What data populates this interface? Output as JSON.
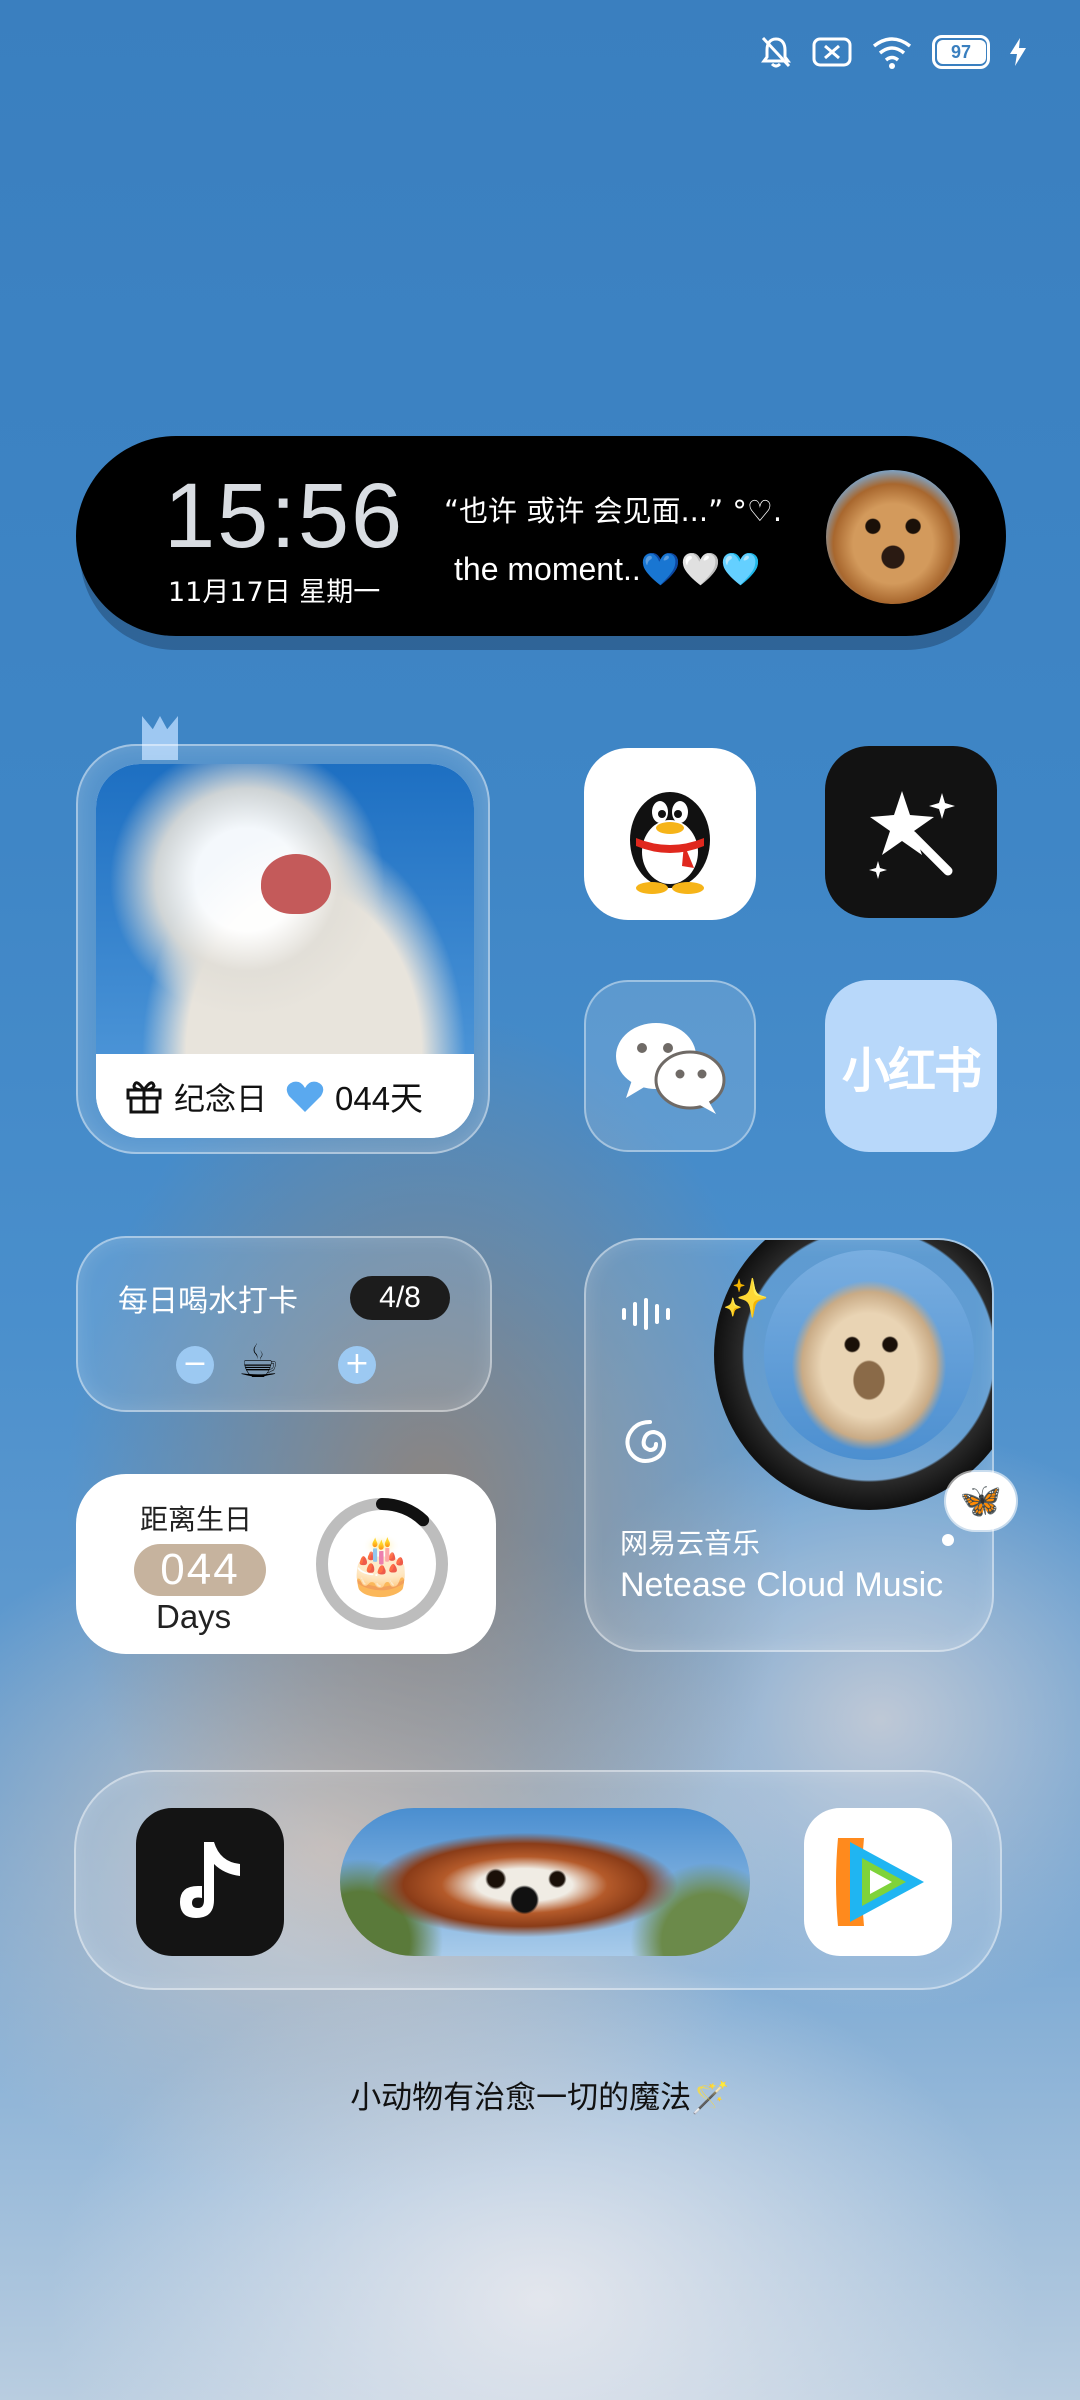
{
  "status_bar": {
    "battery_level": "97",
    "battery_fraction": 0.97
  },
  "time_widget": {
    "time": "15:56",
    "date": "11月17日  星期一",
    "quote_line1": "“也许 或许 会见面...” °♡.",
    "quote_line2": "the moment..💙🤍🩵"
  },
  "photo_widget": {
    "label": "纪念日",
    "count": "044天"
  },
  "apps": {
    "qq": "QQ",
    "magic": "Magic",
    "wechat": "WeChat",
    "xiaohongshu": "小红书",
    "tiktok": "TikTok",
    "tencent_video": "Tencent Video"
  },
  "water_widget": {
    "title": "每日喝水打卡",
    "count": "4/8",
    "minus": "−",
    "plus": "+",
    "cup": "☕"
  },
  "birthday_widget": {
    "title": "距离生日",
    "number": "044",
    "unit": "Days",
    "progress_fraction": 0.12,
    "cake": "🎂"
  },
  "music_widget": {
    "title_cn": "网易云音乐",
    "title_en": "Netease Cloud Music",
    "sparkle": "✨",
    "butterfly": "🦋"
  },
  "slogan": "小动物有治愈一切的魔法🪄",
  "colors": {
    "accent_blue": "#9cc9f2",
    "xhs_bg": "#b8d8fa",
    "pill_bg": "#000000"
  }
}
